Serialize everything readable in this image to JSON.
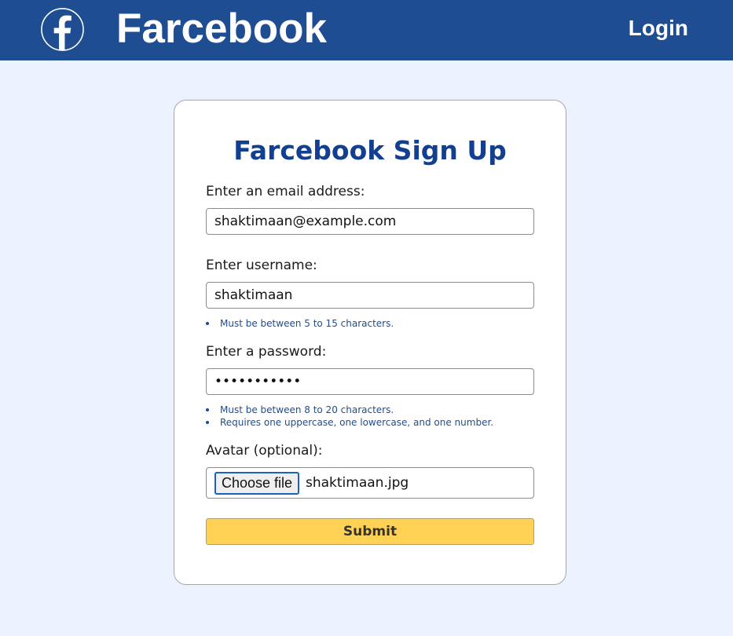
{
  "navbar": {
    "brand": "Farcebook",
    "login_label": "Login",
    "logo_icon": "facebook-f-icon",
    "background": "#1e4d92"
  },
  "form": {
    "title": "Farcebook Sign Up",
    "email": {
      "label": "Enter an email address:",
      "value": "shaktimaan@example.com"
    },
    "username": {
      "label": "Enter username:",
      "value": "shaktimaan",
      "hints": [
        "Must be between 5 to 15 characters."
      ]
    },
    "password": {
      "label": "Enter a password:",
      "value": "Shaktimaan1",
      "hints": [
        "Must be between 8 to 20 characters.",
        "Requires one uppercase, one lowercase, and one number."
      ]
    },
    "avatar": {
      "label": "Avatar (optional):",
      "button_label": "Choose file",
      "file_name": "shaktimaan.jpg"
    },
    "submit_label": "Submit"
  },
  "colors": {
    "page_background": "#ecf3ff",
    "title": "#123f8f",
    "hint": "#1e4d92",
    "submit": "#ffd155"
  }
}
